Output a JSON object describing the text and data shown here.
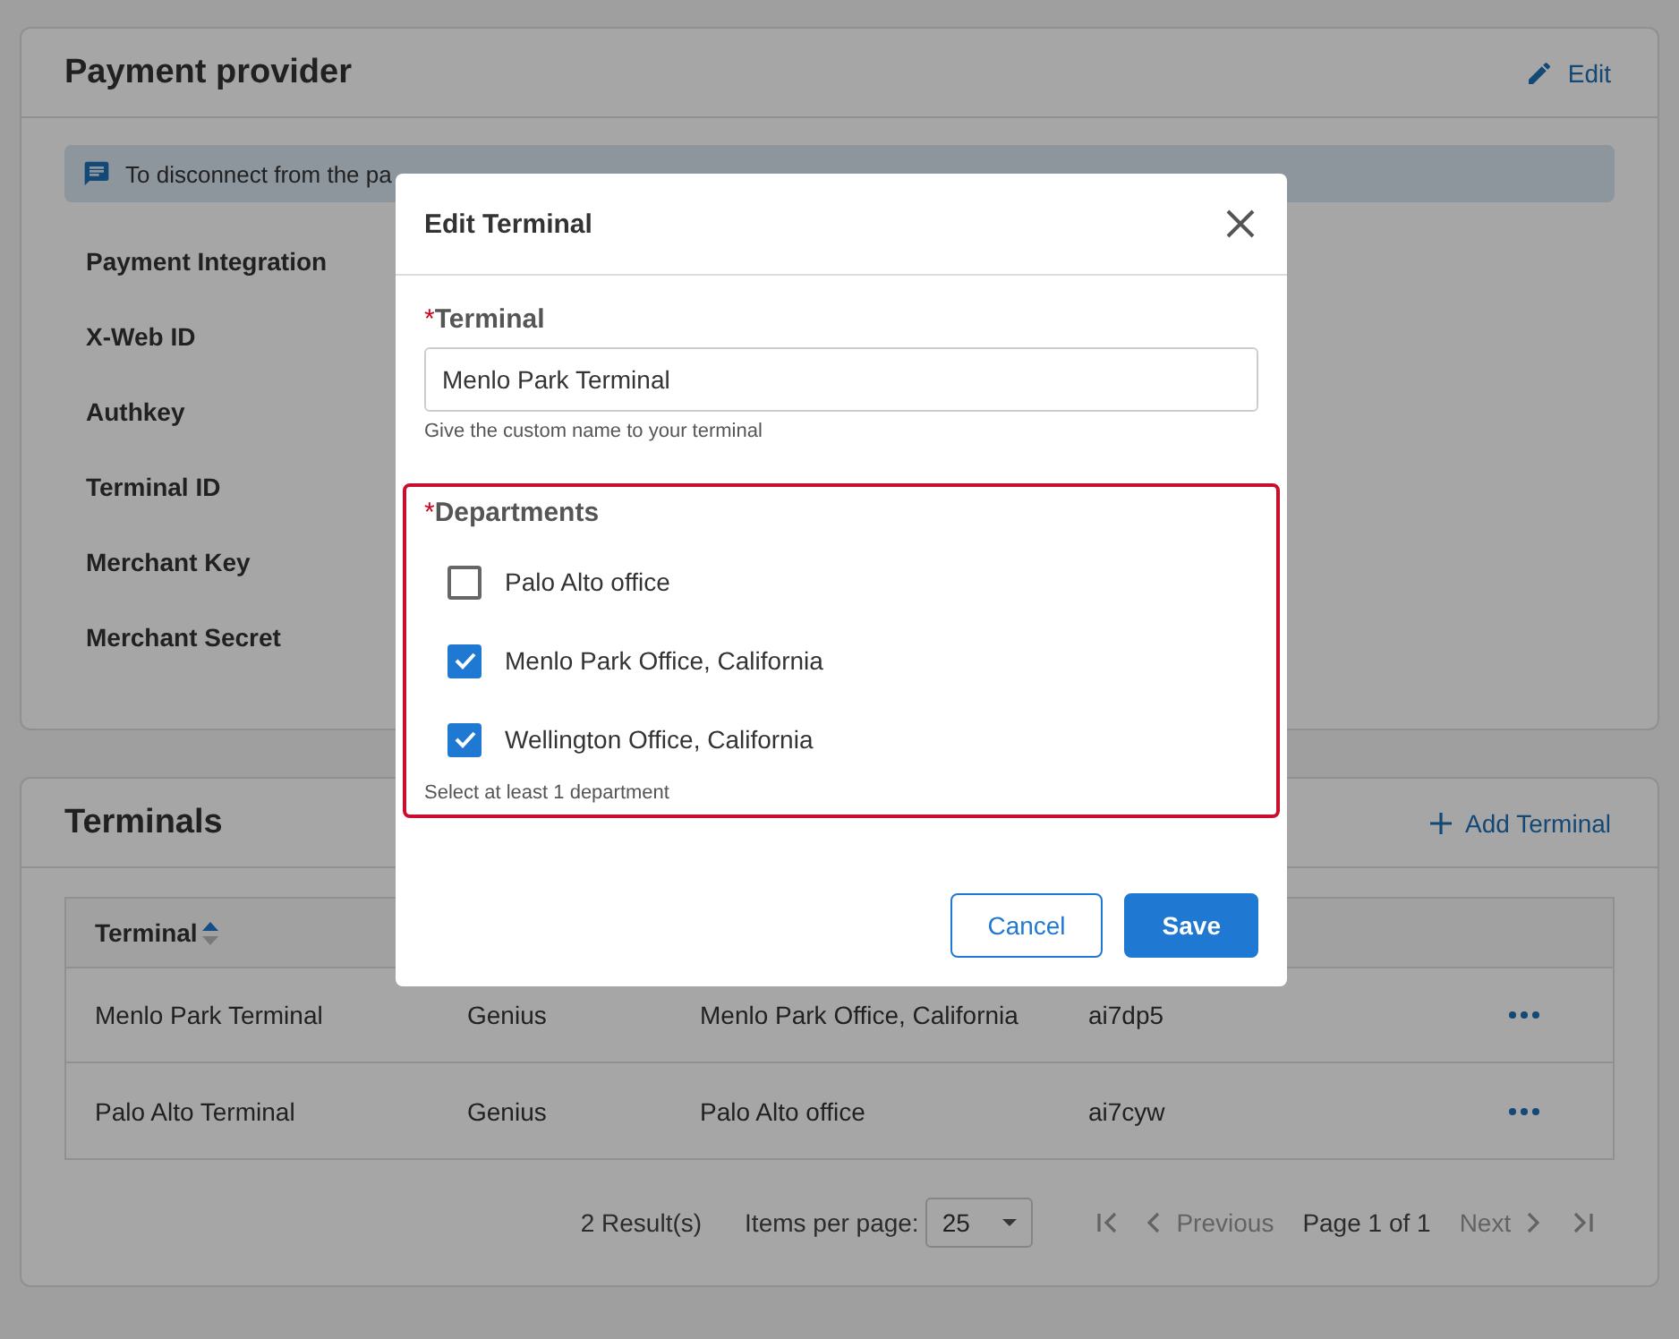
{
  "provider": {
    "title": "Payment provider",
    "edit": "Edit",
    "notice": {
      "text": "To disconnect from the pa"
    },
    "fields": [
      "Payment Integration",
      "X-Web ID",
      "Authkey",
      "Terminal ID",
      "Merchant Key",
      "Merchant Secret"
    ]
  },
  "terminals": {
    "title": "Terminals",
    "add": "Add Terminal",
    "columns": [
      {
        "label": "Terminal",
        "sorted": true
      }
    ],
    "rows": [
      {
        "cells": [
          "Menlo Park Terminal",
          "Genius",
          "Menlo Park Office, California",
          "ai7dp5"
        ]
      },
      {
        "cells": [
          "Palo Alto Terminal",
          "Genius",
          "Palo Alto office",
          "ai7cyw"
        ]
      }
    ],
    "pagination": {
      "results": "2 Result(s)",
      "per_page_label": "Items per page:",
      "per_page": "25",
      "previous": "Previous",
      "page": "Page 1 of 1",
      "next": "Next",
      "first_disabled": true,
      "previous_disabled": true,
      "next_disabled": true,
      "last_disabled": true
    }
  },
  "modal": {
    "title": "Edit Terminal",
    "terminal": {
      "required": "*",
      "label": "Terminal",
      "value": "Menlo Park Terminal",
      "hint": "Give the custom name to your terminal"
    },
    "departments": {
      "required": "*",
      "label": "Departments",
      "error": true,
      "items": [
        {
          "label": "Palo Alto office",
          "checked": false
        },
        {
          "label": "Menlo Park Office, California",
          "checked": true
        },
        {
          "label": "Wellington Office, California",
          "checked": true
        }
      ],
      "hint": "Select at least 1 department"
    },
    "buttons": [
      {
        "label": "Cancel",
        "kind": "secondary"
      },
      {
        "label": "Save",
        "kind": "primary"
      }
    ]
  }
}
